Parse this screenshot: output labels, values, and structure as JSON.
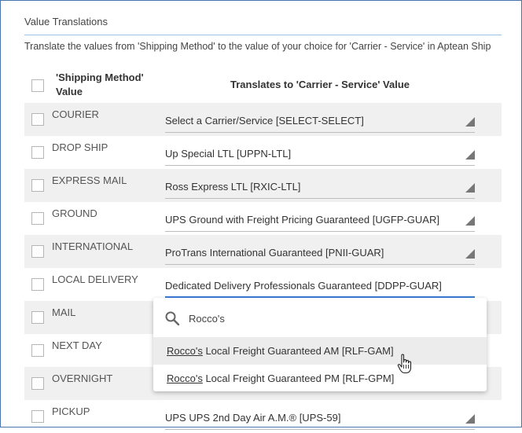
{
  "section": {
    "title": "Value Translations",
    "description": "Translate the values from 'Shipping Method' to the value of your choice for 'Carrier - Service' in Aptean Ship"
  },
  "table": {
    "col1_header": "'Shipping Method' Value",
    "col2_header": "Translates to 'Carrier - Service' Value",
    "rows": [
      {
        "value": "COURIER",
        "translation": "Select a Carrier/Service [SELECT-SELECT]"
      },
      {
        "value": "DROP SHIP",
        "translation": "Up Special LTL [UPPN-LTL]"
      },
      {
        "value": "EXPRESS MAIL",
        "translation": "Ross Express LTL [RXIC-LTL]"
      },
      {
        "value": "GROUND",
        "translation": "UPS Ground with Freight Pricing Guaranteed [UGFP-GUAR]"
      },
      {
        "value": "INTERNATIONAL",
        "translation": "ProTrans International Guaranteed [PNII-GUAR]"
      },
      {
        "value": "LOCAL DELIVERY",
        "translation": "Dedicated Delivery Professionals Guaranteed [DDPP-GUAR]"
      },
      {
        "value": "MAIL",
        "translation": ""
      },
      {
        "value": "NEXT DAY",
        "translation": ""
      },
      {
        "value": "OVERNIGHT",
        "translation": ""
      },
      {
        "value": "PICKUP",
        "translation": "UPS UPS 2nd Day Air A.M.® [UPS-59]"
      }
    ]
  },
  "dropdown": {
    "search_value": "Rocco's",
    "options": [
      {
        "match": "Rocco's",
        "rest": " Local Freight Guaranteed AM [RLF-GAM]"
      },
      {
        "match": "Rocco's",
        "rest": " Local Freight Guaranteed PM [RLF-GPM]"
      }
    ]
  },
  "icons": {
    "search": "search-icon",
    "dropdown_arrow": "triangle-down-icon",
    "cursor": "hand-pointer-icon"
  },
  "colors": {
    "frame_border": "#4a76b0",
    "active_underline": "#3a7bd5",
    "row_shade": "#f0f0f0"
  }
}
